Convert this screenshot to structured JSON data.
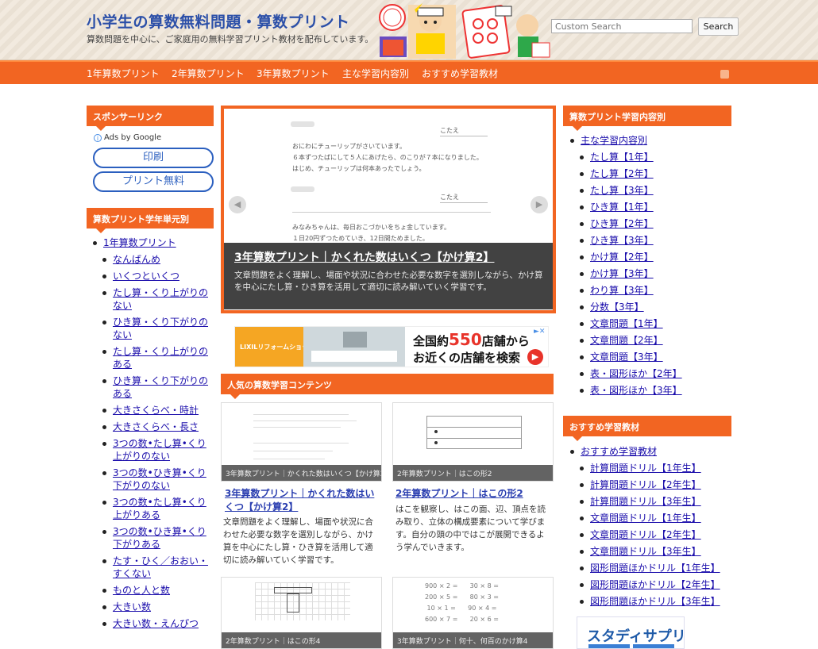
{
  "site": {
    "title": "小学生の算数無料問題・算数プリント",
    "description": "算数問題を中心に、ご家庭用の無料学習プリント教材を配布しています。"
  },
  "search": {
    "placeholder": "Custom Search",
    "button_label": "Search"
  },
  "nav": {
    "items": [
      "1年算数プリント",
      "2年算数プリント",
      "3年算数プリント",
      "主な学習内容別",
      "おすすめ学習教材"
    ]
  },
  "left_sidebar": {
    "sponsor_title": "スポンサーリンク",
    "ads_by": "Ads by Google",
    "ad_links": [
      "印刷",
      "プリント無料"
    ],
    "grade_title": "算数プリント学年単元別",
    "grade_top": "1年算数プリント",
    "grade_items": [
      "なんばんめ",
      "いくつといくつ",
      "たし算・くり上がりのない",
      "ひき算・くり下がりのない",
      "たし算・くり上がりのある",
      "ひき算・くり下がりのある",
      "大きさくらべ・時計",
      "大きさくらべ・長さ",
      "3つの数•たし算•くり上がりのない",
      "3つの数•ひき算•くり下がりのない",
      "3つの数•たし算•くり上がりある",
      "3つの数•ひき算•くり下がりある",
      "たす・ひく／おおい・すくない",
      "ものと人と数",
      "大きい数",
      "大きい数・えんぴつ"
    ]
  },
  "slider": {
    "worksheet_tag": "こたえ",
    "worksheet_lines": [
      "おにわにチューリップがさいています。",
      "６本ずつたばにして５人にあげたら、のこりが７本になりました。",
      "はじめ、チューリップは何本あったでしょう。",
      "みなみちゃんは、毎日おこづかいをちょ金しています。",
      "１日20円ずつためていき、12日間ためました。"
    ],
    "title": "3年算数プリント｜かくれた数はいくつ【かけ算2】",
    "text": "文章問題をよく理解し、場面や状況に合わせた必要な数字を選別しながら、かけ算を中心にたし算・ひき算を活用して適切に読み解いていく学習です。",
    "prev_icon": "chevron-left",
    "next_icon": "chevron-right"
  },
  "ad_banner": {
    "brand": "LIXILリフォームショップ",
    "line1_pre": "全国約",
    "line1_num": "550",
    "line1_post": "店舗から",
    "line2": "お近くの店舗を検索"
  },
  "popular": {
    "title": "人気の算数学習コンテンツ",
    "cards": [
      {
        "caption": "3年算数プリント｜かくれた数はいくつ【かけ算2】",
        "title": "3年算数プリント｜かくれた数はいくつ【かけ算2】",
        "text": "文章問題をよく理解し、場面や状況に合わせた必要な数字を選別しながら、かけ算を中心にたし算・ひき算を活用して適切に読み解いていく学習です。"
      },
      {
        "caption": "2年算数プリント｜はこの形2",
        "title": "2年算数プリント｜はこの形2",
        "text": "はこを観察し、はこの面、辺、頂点を読み取り、立体の構成要素について学びます。自分の頭の中ではこが展開できるよう学んでいきます。"
      },
      {
        "caption": "2年算数プリント｜はこの形4",
        "title": "",
        "text": ""
      },
      {
        "caption": "3年算数プリント｜何十、何百のかけ算4",
        "title": "",
        "text": ""
      }
    ]
  },
  "right_sidebar": {
    "content_title": "算数プリント学習内容別",
    "content_top": "主な学習内容別",
    "content_items": [
      "たし算【1年】",
      "たし算【2年】",
      "たし算【3年】",
      "ひき算【1年】",
      "ひき算【2年】",
      "ひき算【3年】",
      "かけ算【2年】",
      "かけ算【3年】",
      "わり算【3年】",
      "分数【3年】",
      "文章問題【1年】",
      "文章問題【2年】",
      "文章問題【3年】",
      "表・図形ほか【2年】",
      "表・図形ほか【3年】"
    ],
    "material_title": "おすすめ学習教材",
    "material_top": "おすすめ学習教材",
    "material_items": [
      "計算問題ドリル【1年生】",
      "計算問題ドリル【2年生】",
      "計算問題ドリル【3年生】",
      "文章問題ドリル【1年生】",
      "文章問題ドリル【2年生】",
      "文章問題ドリル【3年生】",
      "図形問題ほかドリル【1年生】",
      "図形問題ほかドリル【2年生】",
      "図形問題ほかドリル【3年生】"
    ],
    "banner_text": "スタディサプリ"
  },
  "colors": {
    "accent": "#f26522",
    "link": "#1a0dab",
    "title_blue": "#2b4fa8"
  }
}
